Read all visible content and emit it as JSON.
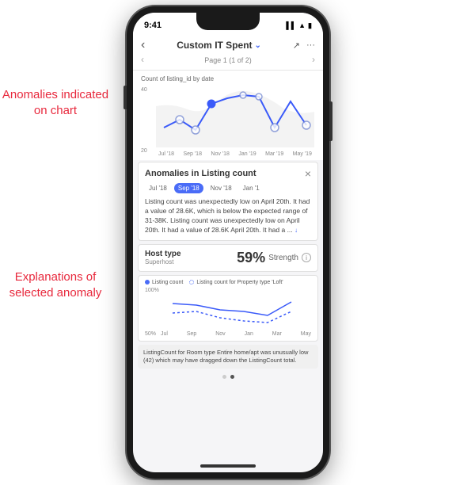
{
  "annotations": {
    "top_text": "Anomalies indicated on chart",
    "bottom_text": "Explanations of selected anomaly"
  },
  "phone": {
    "status": {
      "time": "9:41",
      "icons": "▌▌ ▲ 🔋"
    },
    "header": {
      "back_label": "‹",
      "title": "Custom IT Spent",
      "dropdown_icon": "⌄",
      "expand_icon": "↗",
      "more_icon": "···",
      "subtitle": "Page 1 (1 of 2)",
      "nav_left": "‹",
      "nav_right": "›"
    },
    "chart": {
      "y_label": "Count of listing_id by date",
      "y_max": "40",
      "y_mid": "20",
      "x_labels": [
        "Jul '18",
        "Sep '18",
        "Nov '18",
        "Jan '19",
        "Mar '19",
        "May '19"
      ]
    },
    "anomaly_panel": {
      "title": "Anomalies in Listing count",
      "close_icon": "×",
      "tabs": [
        {
          "label": "Jul '18",
          "active": false
        },
        {
          "label": "Sep '18",
          "active": true
        },
        {
          "label": "Nov '18",
          "active": false
        },
        {
          "label": "Jan '1",
          "active": false
        }
      ],
      "text": "Listing count was unexpectedly low on April 20th. It had a value of 28.6K, which is below the expected range of 31-38K. Listing count was unexpectedly low on April 20th. It had a value of 28.6K April 20th. It had a ...",
      "expand_label": "↓"
    },
    "strength_panel": {
      "label": "Host type",
      "sublabel": "Superhost",
      "percentage": "59%",
      "strength_label": "Strength"
    },
    "mini_chart": {
      "legend": [
        {
          "label": "Listing count",
          "type": "solid"
        },
        {
          "label": "Listing count for Property type 'Loft'",
          "type": "dashed"
        }
      ],
      "y_labels": [
        "100%",
        "50%"
      ],
      "x_labels": [
        "Jul",
        "Sep",
        "Nov",
        "Jan",
        "Mar",
        "May"
      ]
    },
    "bottom_desc": {
      "text": "ListingCount for Room type Entire home/apt was unusually low (42) which may have dragged down the ListingCount total."
    },
    "pagination": {
      "dots": [
        false,
        true
      ]
    }
  }
}
